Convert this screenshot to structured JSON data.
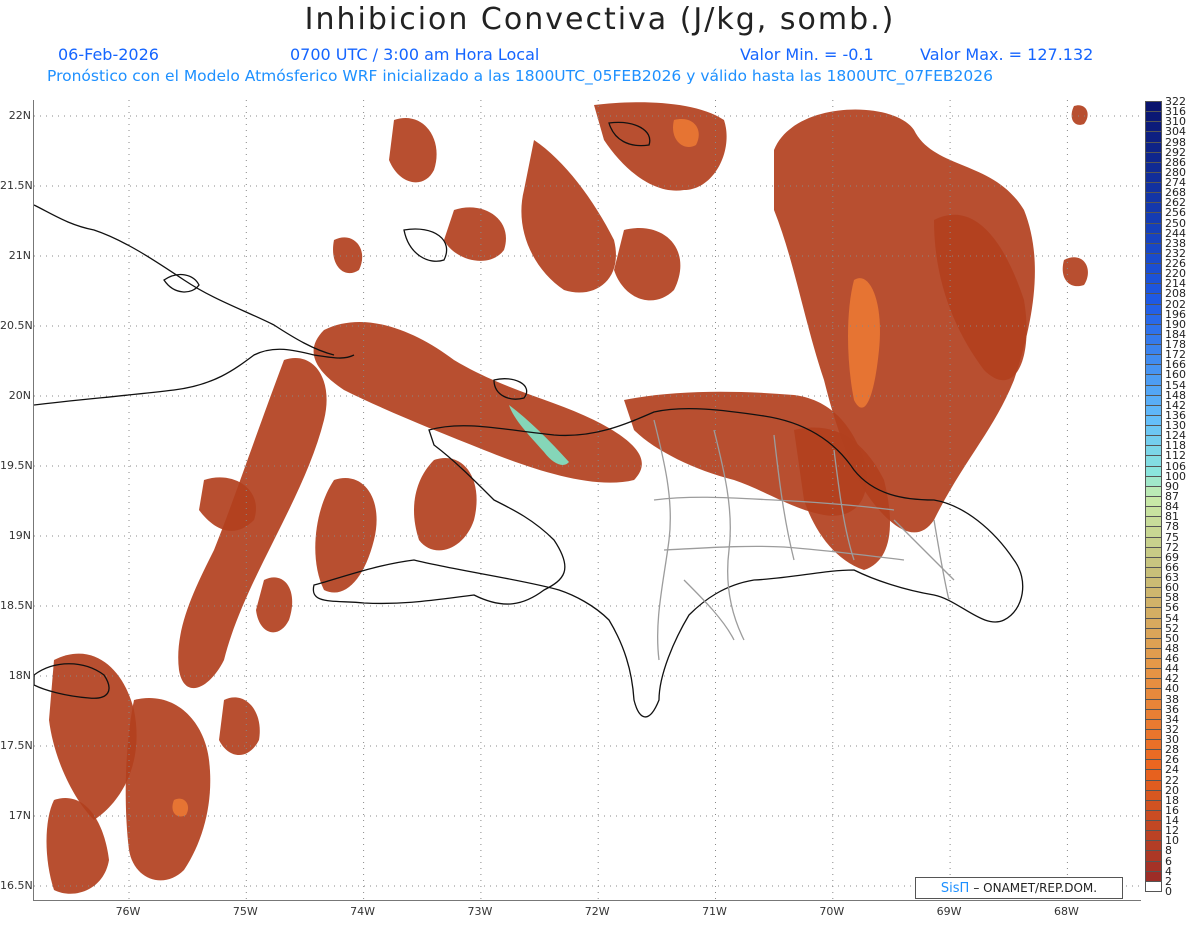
{
  "header": {
    "title": "Inhibicion Convectiva (J/kg, somb.)",
    "date": "06-Feb-2026",
    "time": "0700 UTC / 3:00 am Hora Local",
    "min_label": "Valor Min. = -0.1",
    "max_label": "Valor Max. = 127.132",
    "subtitle": "Pronóstico con el Modelo Atmósferico WRF inicializado a las 1800UTC_05FEB2026 y válido hasta las  1800UTC_07FEB2026"
  },
  "map": {
    "lat_labels": [
      "22N",
      "21.5N",
      "21N",
      "20.5N",
      "20N",
      "19.5N",
      "19N",
      "18.5N",
      "18N",
      "17.5N",
      "17N",
      "16.5N"
    ],
    "lon_labels": [
      "76W",
      "75W",
      "74W",
      "73W",
      "72W",
      "71W",
      "70W",
      "69W",
      "68W"
    ],
    "fill_color": "#b2401e",
    "highlight_color": "#ed7a34",
    "cyan_color": "#7fe4c8"
  },
  "colorbar": {
    "labels": [
      "322",
      "316",
      "310",
      "304",
      "298",
      "292",
      "286",
      "280",
      "274",
      "268",
      "262",
      "256",
      "250",
      "244",
      "238",
      "232",
      "226",
      "220",
      "214",
      "208",
      "202",
      "196",
      "190",
      "184",
      "178",
      "172",
      "166",
      "160",
      "154",
      "148",
      "142",
      "136",
      "130",
      "124",
      "118",
      "112",
      "106",
      "100",
      "90",
      "87",
      "84",
      "81",
      "78",
      "75",
      "72",
      "69",
      "66",
      "63",
      "60",
      "58",
      "56",
      "54",
      "52",
      "50",
      "48",
      "46",
      "44",
      "42",
      "40",
      "38",
      "36",
      "34",
      "32",
      "30",
      "28",
      "26",
      "24",
      "22",
      "20",
      "18",
      "16",
      "14",
      "12",
      "10",
      "8",
      "6",
      "4",
      "2",
      "0"
    ]
  },
  "credit": {
    "logo": "SisΠ",
    "text": "– ONAMET/REP.DOM."
  }
}
